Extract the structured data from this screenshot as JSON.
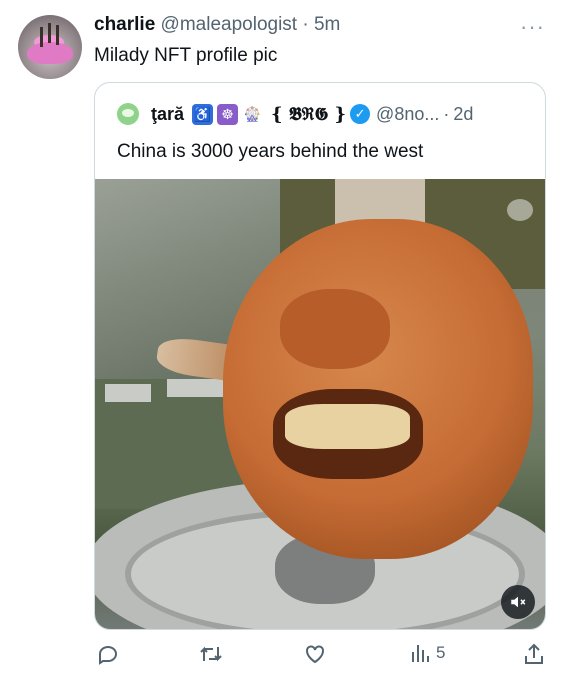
{
  "tweet": {
    "author_name": "charlie",
    "author_handle": "@maleapologist",
    "separator": "·",
    "time": "5m",
    "more": "···",
    "text": "Milady NFT profile pic"
  },
  "quote": {
    "author_name": "ţară",
    "tag": "{ 𝕭ℜ𝕲 }",
    "handle": "@8no...",
    "separator": "·",
    "time": "2d",
    "text": "China is 3000 years behind the west",
    "media": {
      "cc_icon": "captions-icon",
      "mute_icon": "mute-icon"
    }
  },
  "actions": {
    "views_count": "5",
    "icons": [
      "reply-icon",
      "retweet-icon",
      "like-icon",
      "views-icon",
      "share-icon"
    ]
  },
  "colors": {
    "text": "#0f1419",
    "secondary": "#536471",
    "border": "#cfd9de",
    "verified": "#1d9bf0"
  }
}
